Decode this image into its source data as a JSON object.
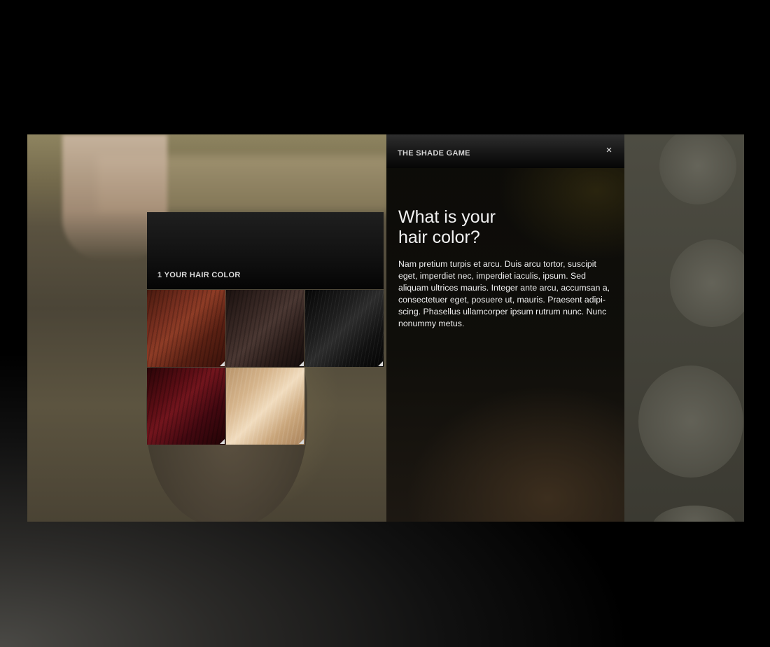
{
  "panel": {
    "title": "THE SHADE GAME",
    "close_label": "×",
    "question_line1": "What is your",
    "question_line2": "hair color?",
    "description": "Nam pretium turpis et arcu. Duis arcu tortor, suscipit eget, imperdiet nec, imperdiet iaculis, ipsum. Sed aliquam ultrices mauris. Integer ante arcu, accumsan a, consectetuer eget, posuere ut, mauris. Praesent adipi-scing. Phasellus ullamcorper ipsum rutrum nunc. Nunc nonummy metus."
  },
  "selector": {
    "step_label": "1 YOUR HAIR COLOR",
    "swatches": [
      {
        "shade": "auburn",
        "color": "#7a3020"
      },
      {
        "shade": "dark-brown",
        "color": "#3c2b27"
      },
      {
        "shade": "black",
        "color": "#1d1d1d"
      },
      {
        "shade": "burgundy",
        "color": "#5a0d14"
      },
      {
        "shade": "blonde",
        "color": "#d6b58c"
      }
    ]
  },
  "colors": {
    "background": "#000000",
    "panel": "#0c0b08",
    "text": "#f2f2f2"
  }
}
